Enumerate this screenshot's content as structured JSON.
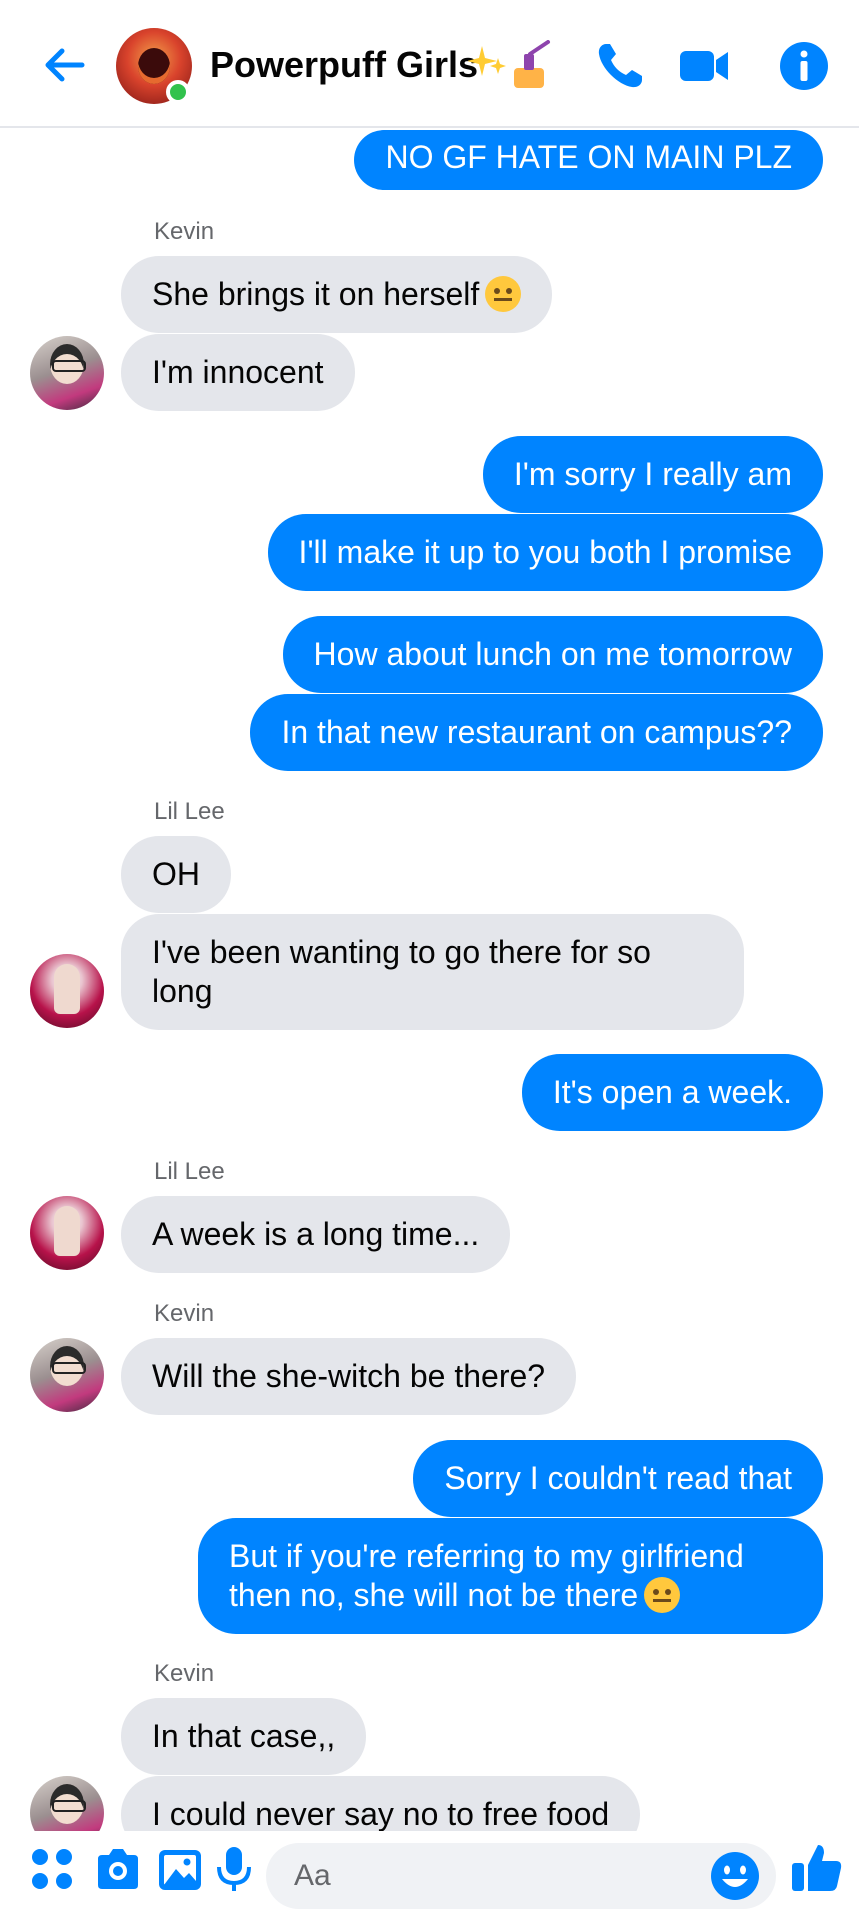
{
  "header": {
    "back_icon": "arrow-left-icon",
    "title": "Powerpuff Girls",
    "title_emoji": "sparkles-nail-polish-emoji",
    "call_icon": "phone-icon",
    "video_icon": "video-camera-icon",
    "info_icon": "info-icon",
    "accent_color": "#0084ff"
  },
  "messages": [
    {
      "side": "out",
      "text": "NO GF HATE ON MAIN PLZ"
    },
    {
      "side": "in",
      "sender": "Kevin"
    },
    {
      "side": "in",
      "text": "She brings it on herself"
    },
    {
      "side": "in",
      "text": "I'm innocent"
    },
    {
      "side": "out",
      "text": "I'm sorry I really am"
    },
    {
      "side": "out",
      "text": "I'll make it up to you both I promise"
    },
    {
      "side": "out",
      "text": "How about lunch on me tomorrow"
    },
    {
      "side": "out",
      "text": "In that new restaurant on campus??"
    },
    {
      "side": "in",
      "sender": "Lil Lee"
    },
    {
      "side": "in",
      "text": "OH"
    },
    {
      "side": "in",
      "text": "I've been wanting to go there for so long"
    },
    {
      "side": "out",
      "text": "It's open a week."
    },
    {
      "side": "in",
      "sender": "Lil Lee"
    },
    {
      "side": "in",
      "text": "A week is a long time..."
    },
    {
      "side": "in",
      "sender": "Kevin"
    },
    {
      "side": "in",
      "text": "Will the she-witch be there?"
    },
    {
      "side": "out",
      "text": "Sorry I couldn't read that"
    },
    {
      "side": "out",
      "text": "But if you're referring to my girlfriend then no, she will not be there"
    },
    {
      "side": "in",
      "sender": "Kevin"
    },
    {
      "side": "in",
      "text": "In that case,,"
    },
    {
      "side": "in",
      "text": "I could never say no to free food"
    }
  ],
  "composer": {
    "placeholder": "Aa",
    "icons": [
      "apps-icon",
      "camera-icon",
      "gallery-icon",
      "microphone-icon",
      "emoji-icon",
      "thumbs-up-icon"
    ]
  }
}
